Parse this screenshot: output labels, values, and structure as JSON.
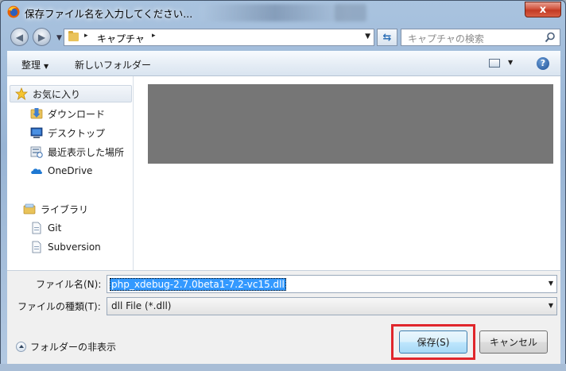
{
  "window": {
    "title": "保存ファイル名を入力してください...",
    "close_glyph": "x",
    "accent": "#3399ff",
    "highlight_color": "#e0262b"
  },
  "address_bar": {
    "path": [
      "キャプチャ"
    ],
    "separator": "▸"
  },
  "search": {
    "placeholder": "キャプチャの検索"
  },
  "toolbar": {
    "organize_label": "整理",
    "new_folder_label": "新しいフォルダー",
    "help_glyph": "?"
  },
  "sidebar": {
    "favorites_label": "お気に入り",
    "favorites": [
      {
        "label": "ダウンロード",
        "icon": "download-folder-icon"
      },
      {
        "label": "デスクトップ",
        "icon": "desktop-icon"
      },
      {
        "label": "最近表示した場所",
        "icon": "recent-places-icon"
      },
      {
        "label": "OneDrive",
        "icon": "cloud-icon"
      }
    ],
    "libraries_label": "ライブラリ",
    "libraries": [
      {
        "label": "Git",
        "icon": "document-icon"
      },
      {
        "label": "Subversion",
        "icon": "document-icon"
      }
    ]
  },
  "form": {
    "filename_label": "ファイル名(N):",
    "filename_value": "php_xdebug-2.7.0beta1-7.2-vc15.dll",
    "filetype_label": "ファイルの種類(T):",
    "filetype_value": "dll File (*.dll)"
  },
  "footer": {
    "hide_folders_label": "フォルダーの非表示",
    "save_label": "保存(S)",
    "cancel_label": "キャンセル"
  }
}
